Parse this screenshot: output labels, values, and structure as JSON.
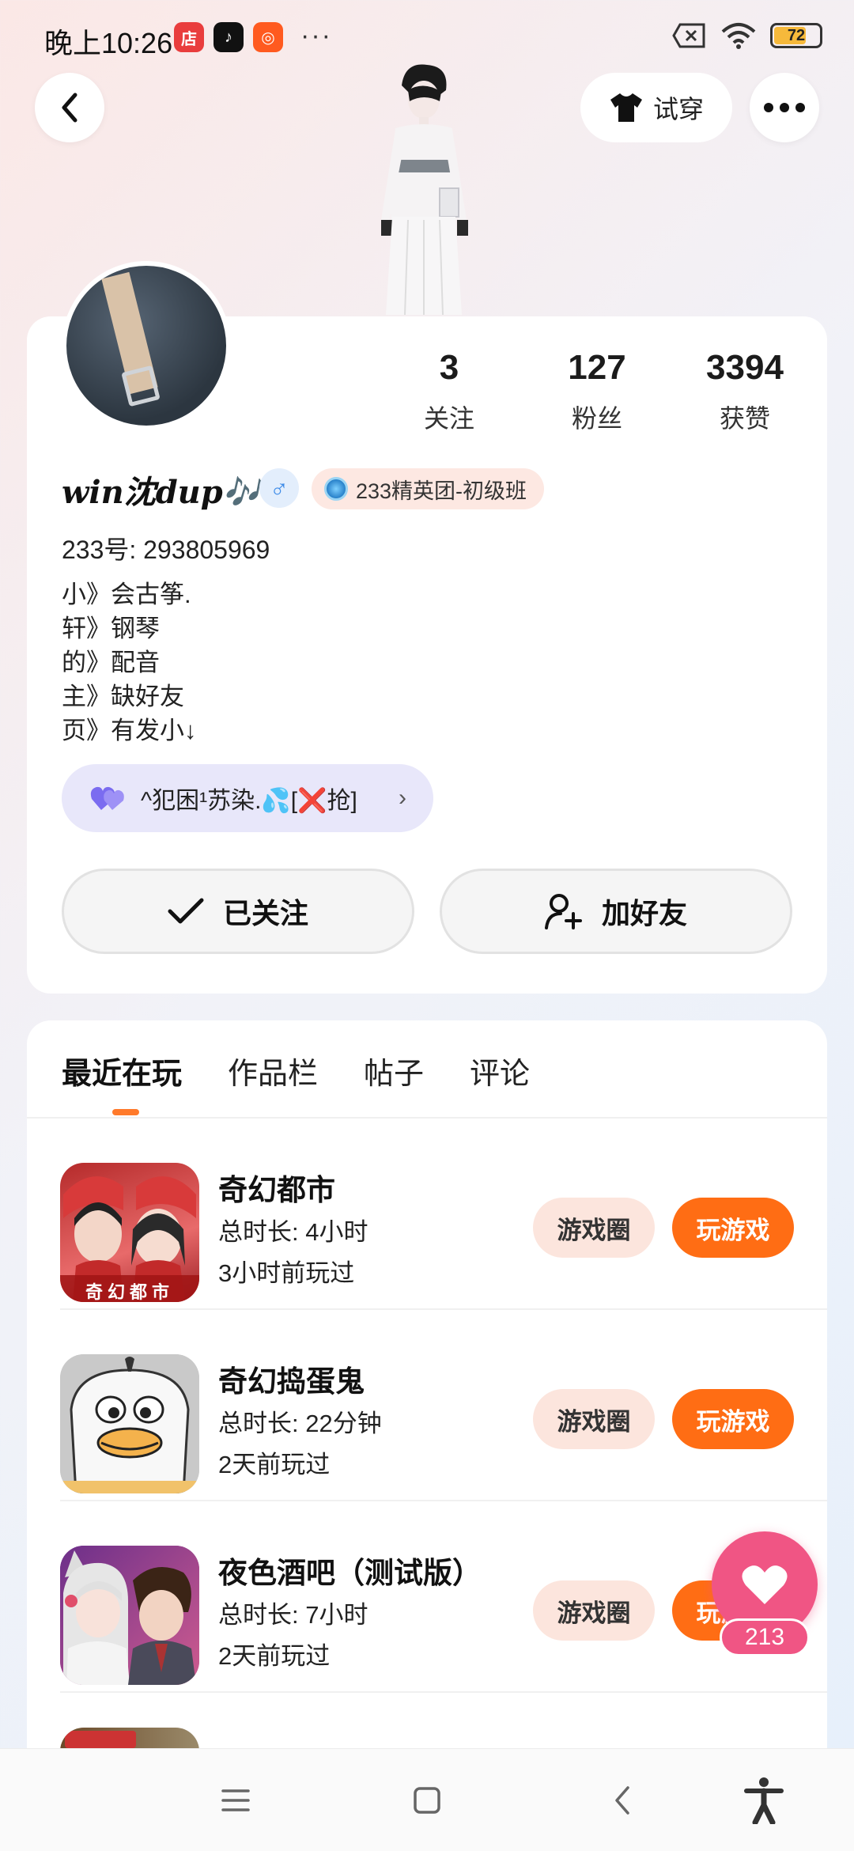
{
  "status_bar": {
    "time": "晚上10:26",
    "battery": "72",
    "more": "···"
  },
  "top_nav": {
    "try_on_label": "试穿"
  },
  "profile": {
    "stats": [
      {
        "value": "3",
        "label": "关注"
      },
      {
        "value": "127",
        "label": "粉丝"
      },
      {
        "value": "3394",
        "label": "获赞"
      }
    ],
    "username": "win沈dup🎶",
    "gender_symbol": "♂",
    "title_badge": "233精英团-初级班",
    "user_id": "233号: 293805969",
    "bio_lines": [
      "小》会古筝.",
      "轩》钢琴",
      "的》配音",
      "主》缺好友",
      "页》有发小↓"
    ],
    "guild_chip": "^犯困¹苏染.💦[❌抢]",
    "follow_button": "已关注",
    "add_friend_button": "加好友"
  },
  "tabs": [
    {
      "label": "最近在玩",
      "active": true
    },
    {
      "label": "作品栏",
      "active": false
    },
    {
      "label": "帖子",
      "active": false
    },
    {
      "label": "评论",
      "active": false
    }
  ],
  "games": [
    {
      "name": "奇幻都市",
      "duration": "总时长: 4小时",
      "last_played": "3小时前玩过",
      "icon_text": "奇幻都市"
    },
    {
      "name": "奇幻捣蛋鬼",
      "duration": "总时长: 22分钟",
      "last_played": "2天前玩过",
      "icon_text": ""
    },
    {
      "name": "夜色酒吧（测试版）",
      "duration": "总时长: 7小时",
      "last_played": "2天前玩过",
      "icon_text": ""
    }
  ],
  "game_buttons": {
    "circle": "游戏圈",
    "play": "玩游戏"
  },
  "like": {
    "count": "213"
  },
  "colors": {
    "accent_orange": "#ff6d14",
    "like_pink": "#f05584",
    "chip_lavender": "#e8e7fa"
  }
}
